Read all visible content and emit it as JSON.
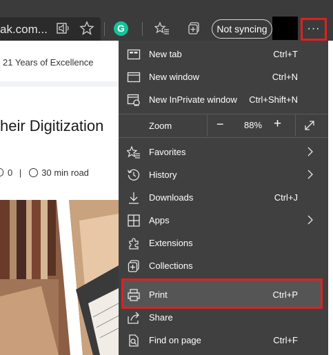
{
  "toolbar": {
    "address_text": "ak.com...",
    "sync_label": "Not syncing",
    "more_label": "···",
    "grammarly_letter": "G"
  },
  "page": {
    "tagline": "21 Years of Excellence",
    "headline": "heir Digitization",
    "comments": "0",
    "read_time": "30 min road"
  },
  "menu": {
    "items": [
      {
        "label": "New tab",
        "shortcut": "Ctrl+T",
        "icon": "new-tab-icon"
      },
      {
        "label": "New window",
        "shortcut": "Ctrl+N",
        "icon": "new-window-icon"
      },
      {
        "label": "New InPrivate window",
        "shortcut": "Ctrl+Shift+N",
        "icon": "inprivate-icon"
      },
      {
        "label": "Favorites",
        "shortcut": "",
        "icon": "favorites-icon"
      },
      {
        "label": "History",
        "shortcut": "",
        "icon": "history-icon"
      },
      {
        "label": "Downloads",
        "shortcut": "Ctrl+J",
        "icon": "download-icon"
      },
      {
        "label": "Apps",
        "shortcut": "",
        "icon": "apps-icon"
      },
      {
        "label": "Extensions",
        "shortcut": "",
        "icon": "extensions-icon"
      },
      {
        "label": "Collections",
        "shortcut": "",
        "icon": "collections-icon"
      },
      {
        "label": "Print",
        "shortcut": "Ctrl+P",
        "icon": "print-icon"
      },
      {
        "label": "Share",
        "shortcut": "",
        "icon": "share-icon"
      },
      {
        "label": "Find on page",
        "shortcut": "Ctrl+F",
        "icon": "find-icon"
      }
    ],
    "zoom": {
      "label": "Zoom",
      "value": "88%",
      "minus": "−",
      "plus": "+"
    }
  },
  "colors": {
    "menu_bg": "#404040",
    "toolbar_bg": "#3b3b3b",
    "highlight": "#e02020",
    "grammarly": "#15c39a"
  }
}
